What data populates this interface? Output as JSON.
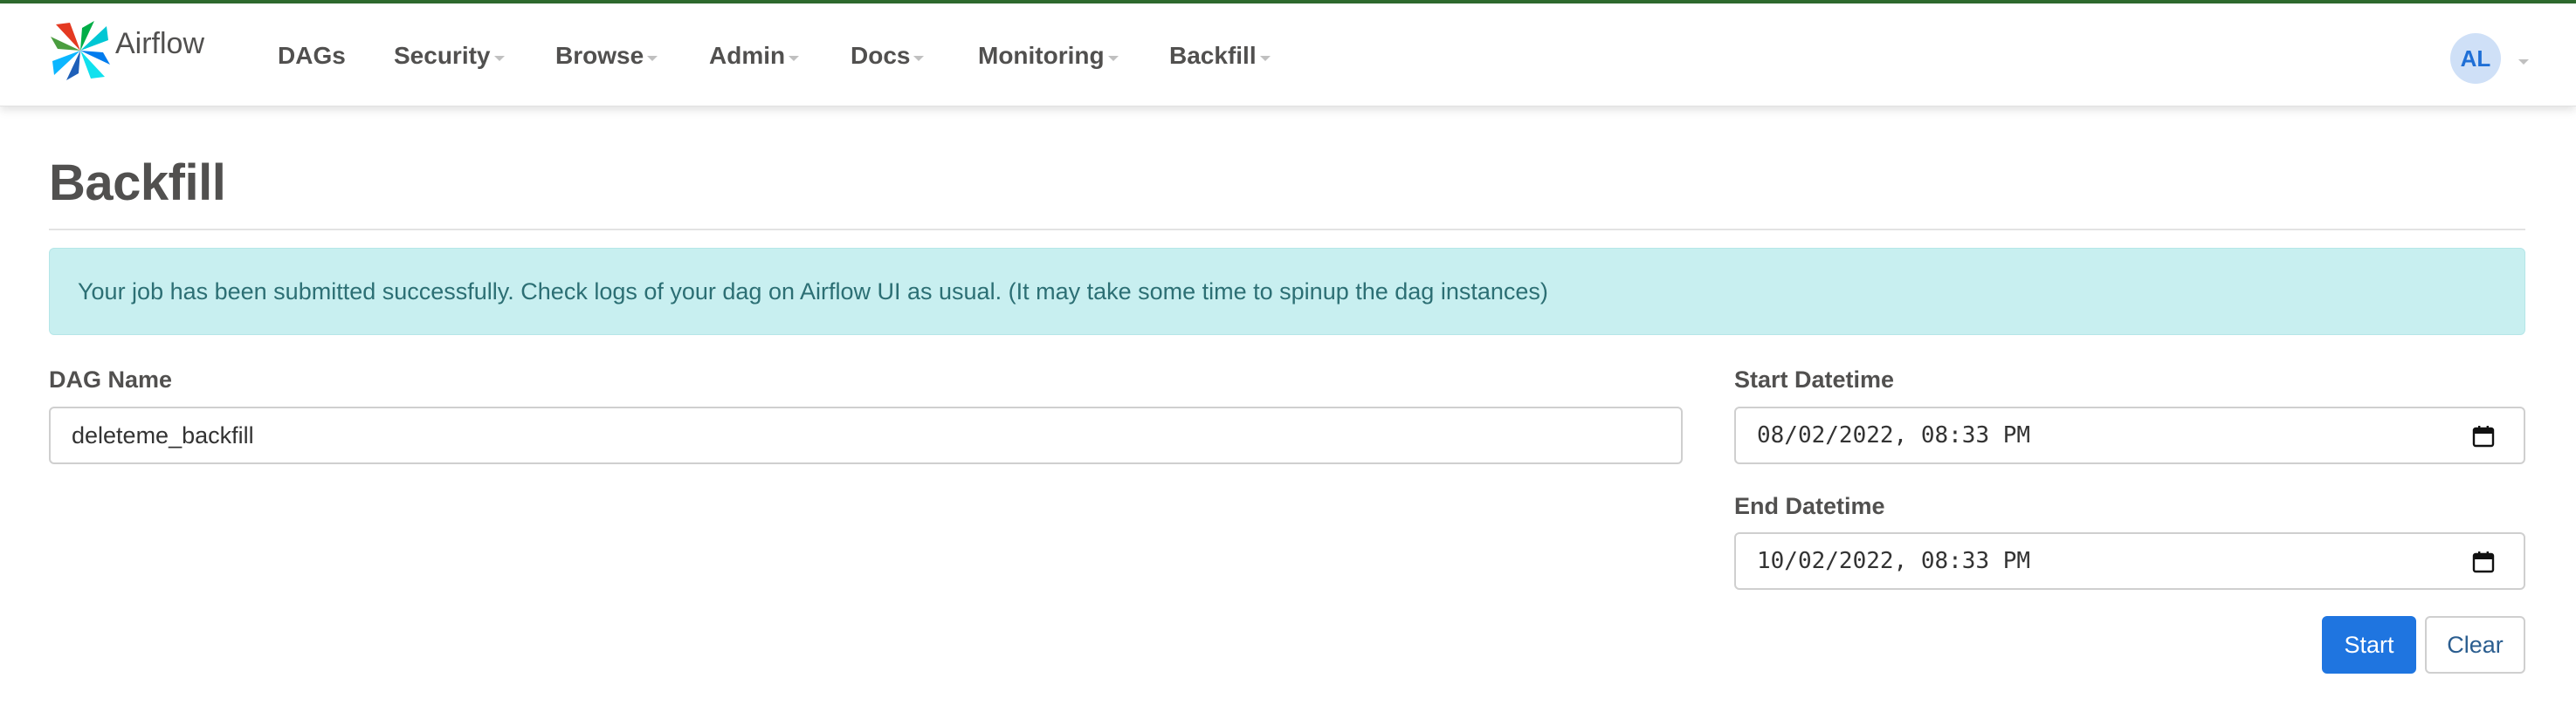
{
  "brand": {
    "name": "Airflow"
  },
  "nav": {
    "items": [
      {
        "label": "DAGs",
        "has_dropdown": false
      },
      {
        "label": "Security",
        "has_dropdown": true
      },
      {
        "label": "Browse",
        "has_dropdown": true
      },
      {
        "label": "Admin",
        "has_dropdown": true
      },
      {
        "label": "Docs",
        "has_dropdown": true
      },
      {
        "label": "Monitoring",
        "has_dropdown": true
      },
      {
        "label": "Backfill",
        "has_dropdown": true
      }
    ],
    "user_initials": "AL"
  },
  "page": {
    "title": "Backfill",
    "alert": "Your job has been submitted successfully. Check logs of your dag on Airflow UI as usual. (It may take some time to spinup the dag instances)"
  },
  "form": {
    "dag_name": {
      "label": "DAG Name",
      "value": "deleteme_backfill"
    },
    "start_datetime": {
      "label": "Start Datetime",
      "value": "08/02/2022, 08:33 PM"
    },
    "end_datetime": {
      "label": "End Datetime",
      "value": "10/02/2022, 08:33 PM"
    },
    "start_button": "Start",
    "clear_button": "Clear"
  },
  "colors": {
    "primary": "#1f75e0",
    "alert_bg": "#c8eff0",
    "alert_text": "#2c6f74",
    "top_border": "#2e6b2e"
  },
  "icons": {
    "logo": "airflow-pinwheel-icon",
    "calendar": "calendar-icon",
    "caret": "caret-down-icon"
  }
}
